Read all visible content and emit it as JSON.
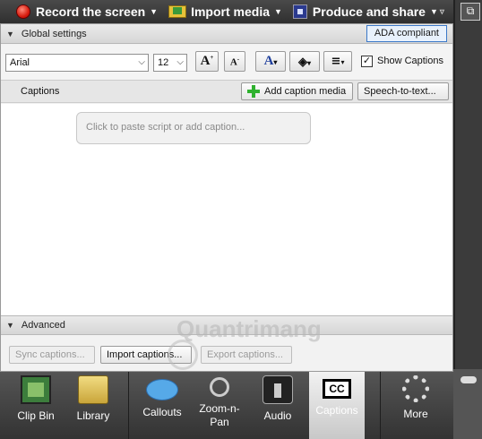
{
  "toolbar": {
    "record": "Record the screen",
    "import": "Import media",
    "produce": "Produce and share"
  },
  "global": {
    "title": "Global settings",
    "ada": "ADA compliant",
    "font": "Arial",
    "size": "12",
    "show_captions": "Show Captions"
  },
  "captions": {
    "title": "Captions",
    "add_media": "Add caption media",
    "speech": "Speech-to-text...",
    "placeholder": "Click to paste script or add caption..."
  },
  "advanced": {
    "title": "Advanced",
    "sync": "Sync captions...",
    "import": "Import captions...",
    "export": "Export captions..."
  },
  "watermark": "Quantrimang",
  "tabs": [
    {
      "label": "Clip Bin"
    },
    {
      "label": "Library"
    },
    {
      "label": "Callouts"
    },
    {
      "label": "Zoom-n-\nPan"
    },
    {
      "label": "Audio"
    },
    {
      "label": "Captions",
      "cc": "CC"
    },
    {
      "label": "More"
    }
  ],
  "colors": {
    "accent": "#3b78c8",
    "active_tab": "#e8e8e8"
  }
}
